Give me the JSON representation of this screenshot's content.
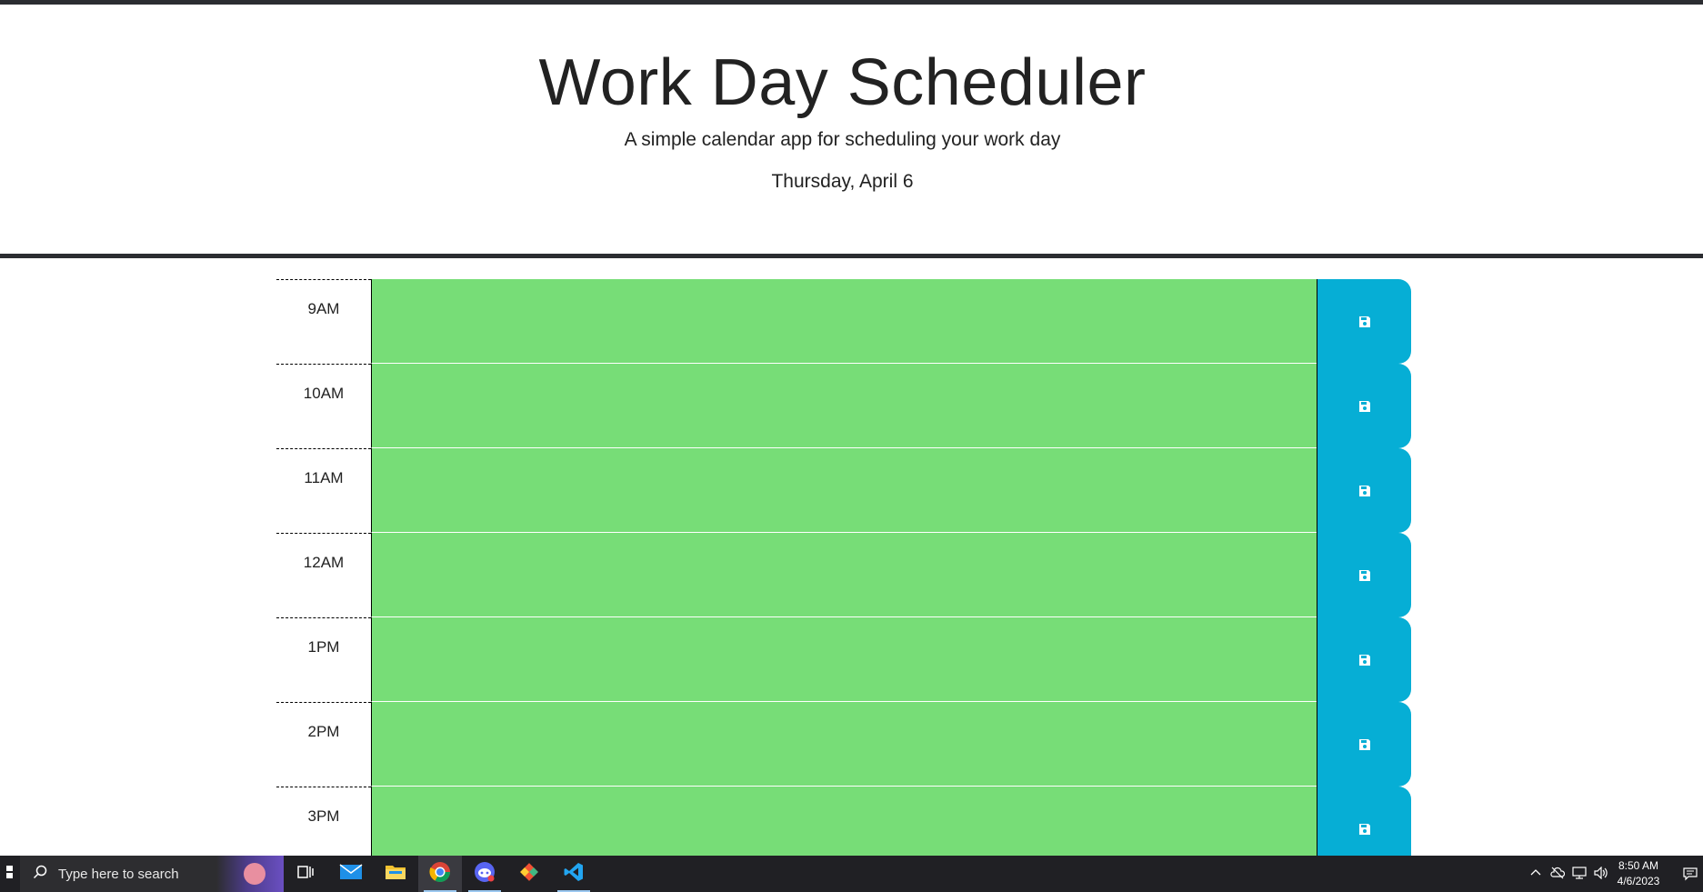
{
  "header": {
    "title": "Work Day Scheduler",
    "subtitle": "A simple calendar app for scheduling your work day",
    "current_day": "Thursday, April 6"
  },
  "schedule": {
    "hours": [
      {
        "label": "9AM",
        "state": "future"
      },
      {
        "label": "10AM",
        "state": "future"
      },
      {
        "label": "11AM",
        "state": "future"
      },
      {
        "label": "12AM",
        "state": "future"
      },
      {
        "label": "1PM",
        "state": "future"
      },
      {
        "label": "2PM",
        "state": "future"
      },
      {
        "label": "3PM",
        "state": "future"
      }
    ],
    "save_icon": "floppy-disk-icon"
  },
  "colors": {
    "future": "#77dd77",
    "save_button": "#06aed5",
    "header_rule": "#2b2d31"
  },
  "taskbar": {
    "search_placeholder": "Type here to search",
    "apps": [
      "task-view-icon",
      "mail-icon",
      "file-explorer-icon",
      "chrome-icon",
      "discord-icon",
      "git-icon",
      "vscode-icon"
    ],
    "time": "8:50 AM",
    "date": "4/6/2023"
  }
}
